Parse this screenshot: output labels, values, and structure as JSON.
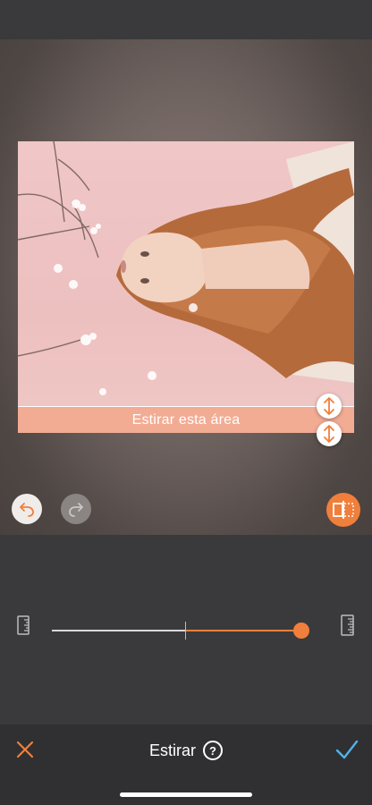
{
  "editor": {
    "stretch_area_label": "Estirar esta área",
    "stretch_amount": 0.95,
    "tool_title": "Estirar"
  },
  "icons": {
    "undo": "undo-arrow-icon",
    "redo": "redo-arrow-icon",
    "compare": "compare-split-icon",
    "handle": "vertical-resize-icon",
    "ruler": "ruler-icon",
    "cancel": "close-x-icon",
    "confirm": "checkmark-icon",
    "help": "question-circle-icon"
  },
  "colors": {
    "accent": "#f07f3c",
    "confirm": "#4fb3e8",
    "panel": "#3a3a3c",
    "band": "#f3a487"
  },
  "help_glyph": "?"
}
